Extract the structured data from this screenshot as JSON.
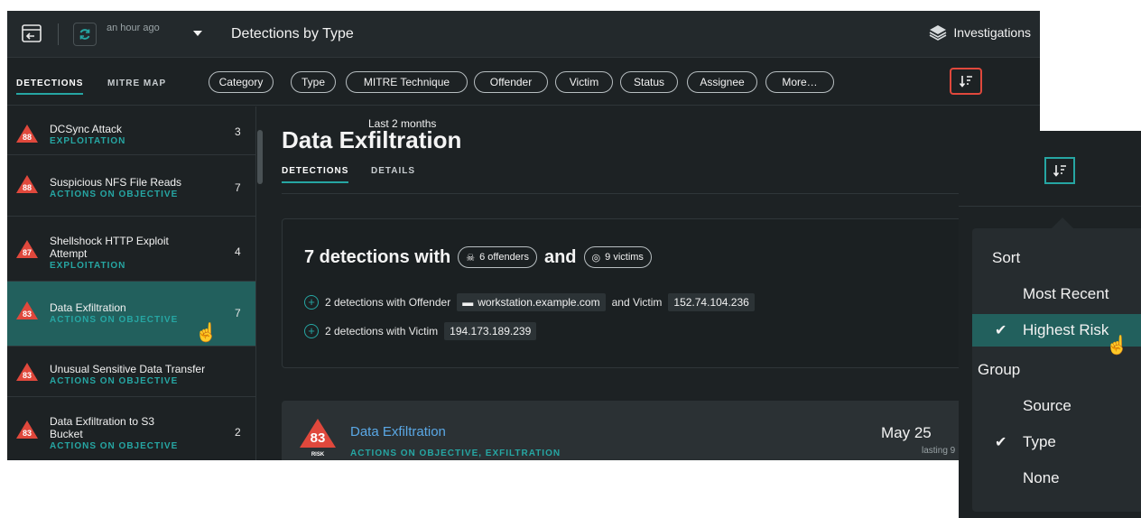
{
  "topbar": {
    "time_range": "Last 2 months",
    "time_updated": "an hour ago",
    "title": "Detections by Type",
    "investigations": "Investigations"
  },
  "filterbar": {
    "tabs": [
      "DETECTIONS",
      "MITRE MAP"
    ],
    "chips": [
      "Category",
      "Type",
      "MITRE Technique",
      "Offender",
      "Victim",
      "Status",
      "Assignee",
      "More…"
    ]
  },
  "sidebar": {
    "items": [
      {
        "risk": "88",
        "name": "DCSync Attack",
        "category": "EXPLOITATION",
        "count": "3"
      },
      {
        "risk": "88",
        "name": "Suspicious NFS File Reads",
        "category": "ACTIONS ON OBJECTIVE",
        "count": "7"
      },
      {
        "risk": "87",
        "name": "Shellshock HTTP Exploit Attempt",
        "category": "EXPLOITATION",
        "count": "4"
      },
      {
        "risk": "83",
        "name": "Data Exfiltration",
        "category": "ACTIONS ON OBJECTIVE",
        "count": "7"
      },
      {
        "risk": "83",
        "name": "Unusual Sensitive Data Transfer",
        "category": "ACTIONS ON OBJECTIVE",
        "count": ""
      },
      {
        "risk": "83",
        "name": "Data Exfiltration to S3 Bucket",
        "category": "ACTIONS ON OBJECTIVE",
        "count": "2"
      }
    ]
  },
  "main": {
    "title": "Data Exfiltration",
    "tabs": [
      "DETECTIONS",
      "DETAILS"
    ],
    "summary": {
      "prefix": "7 detections with",
      "offenders": "6 offenders",
      "and": "and",
      "victims": "9 victims",
      "row1_text": "2 detections with Offender",
      "row1_offender": "workstation.example.com",
      "row1_and_victim": "and Victim",
      "row1_victim": "152.74.104.236",
      "row2_text": "2 detections with Victim",
      "row2_victim": "194.173.189.239"
    },
    "card": {
      "risk": "83",
      "risk_label": "RISK",
      "title": "Data Exfiltration",
      "category": "ACTIONS ON OBJECTIVE, EXFILTRATION",
      "date": "May 25",
      "lasting": "lasting 9"
    }
  },
  "popover": {
    "sort_heading": "Sort",
    "sort_options": [
      "Most Recent",
      "Highest Risk"
    ],
    "sort_selected": "Highest Risk",
    "group_heading": "Group",
    "group_options": [
      "Source",
      "Type",
      "None"
    ],
    "group_selected": "Type"
  },
  "colors": {
    "accent": "#26a6a3",
    "risk": "#e0483c",
    "link": "#5aa8e6",
    "selected_row": "#22605d"
  }
}
